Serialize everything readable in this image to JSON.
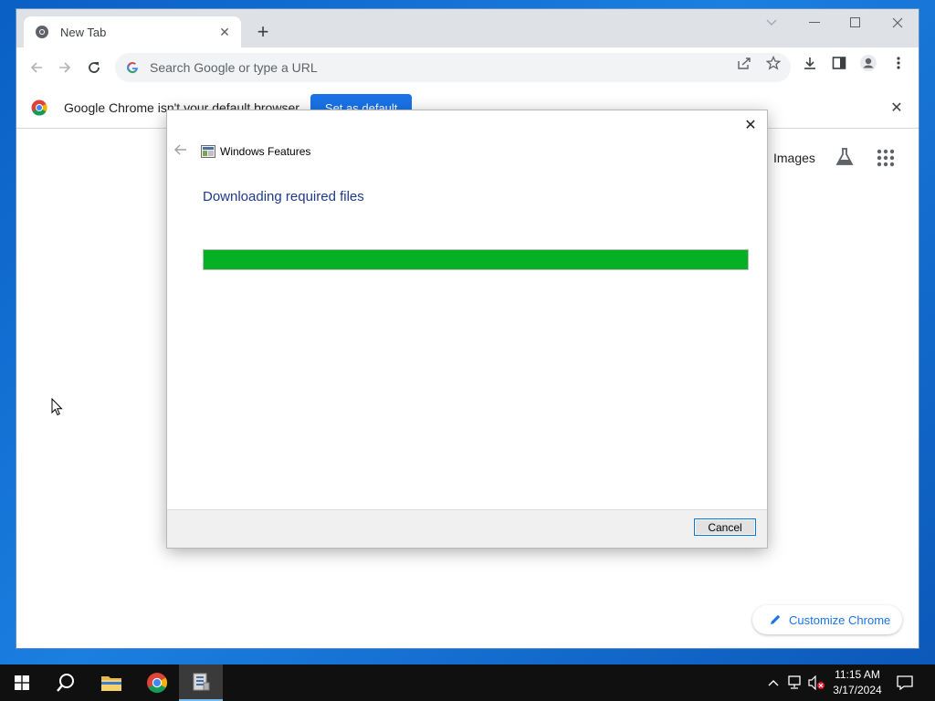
{
  "browser": {
    "tab_title": "New Tab",
    "omnibox_placeholder": "Search Google or type a URL",
    "infobar_message": "Google Chrome isn't your default browser",
    "set_default_label": "Set as default",
    "ntp_images_label": "Images",
    "customize_label": "Customize Chrome"
  },
  "dialog": {
    "app_title": "Windows Features",
    "heading": "Downloading required files",
    "progress_percent": 100,
    "cancel_label": "Cancel"
  },
  "taskbar": {
    "time": "11:15 AM",
    "date": "3/17/2024"
  },
  "colors": {
    "progress_fill": "#06b025",
    "chrome_blue": "#1a73e8",
    "taskbar_bg": "#101010"
  },
  "icons": [
    "chrome-favicon",
    "google-g-icon",
    "share-icon",
    "star-icon",
    "download-icon",
    "side-panel-icon",
    "profile-icon",
    "menu-icon",
    "flask-icon",
    "apps-grid-icon",
    "pencil-icon",
    "windows-start-icon",
    "search-icon",
    "file-explorer-icon",
    "chrome-taskbar-icon",
    "windows-features-icon",
    "network-icon",
    "volume-muted-icon",
    "notification-icon"
  ]
}
